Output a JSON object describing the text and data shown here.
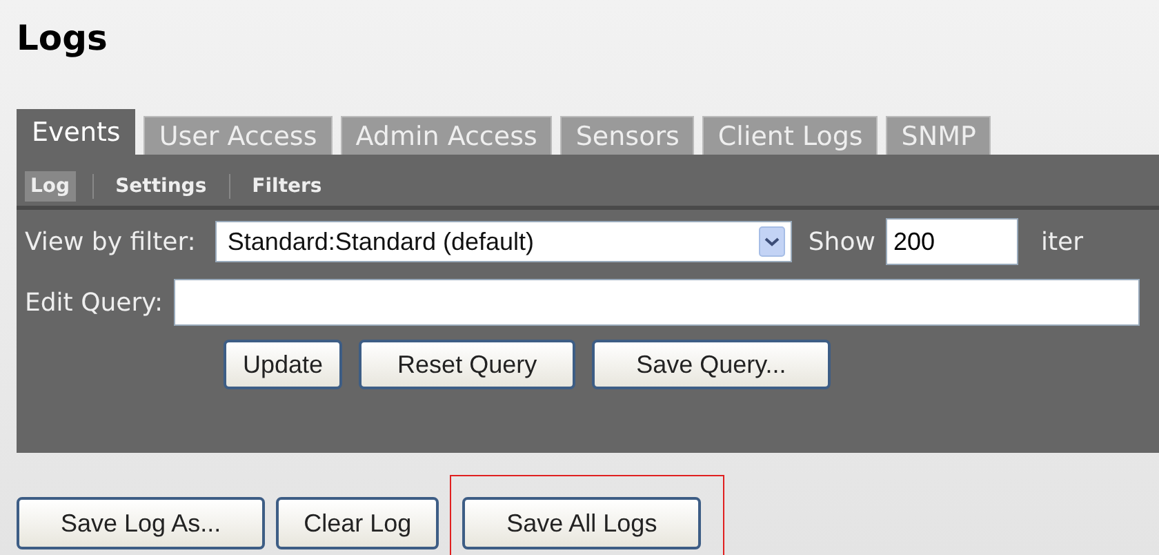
{
  "page_title": "Logs",
  "tabs": [
    {
      "label": "Events",
      "selected": true
    },
    {
      "label": "User Access",
      "selected": false
    },
    {
      "label": "Admin Access",
      "selected": false
    },
    {
      "label": "Sensors",
      "selected": false
    },
    {
      "label": "Client Logs",
      "selected": false
    },
    {
      "label": "SNMP",
      "selected": false
    }
  ],
  "subtabs": [
    {
      "label": "Log",
      "selected": true
    },
    {
      "label": "Settings",
      "selected": false
    },
    {
      "label": "Filters",
      "selected": false
    }
  ],
  "filter": {
    "label": "View by filter:",
    "value": "Standard:Standard (default)",
    "show_label": "Show",
    "show_value": "200",
    "items_label": "iter"
  },
  "query": {
    "label": "Edit Query:"
  },
  "query_buttons": [
    "Update",
    "Reset Query",
    "Save Query..."
  ],
  "log_buttons": [
    {
      "label": "Save Log As...",
      "highlighted": false
    },
    {
      "label": "Clear Log",
      "highlighted": false
    },
    {
      "label": "Save All Logs",
      "highlighted": true
    }
  ]
}
